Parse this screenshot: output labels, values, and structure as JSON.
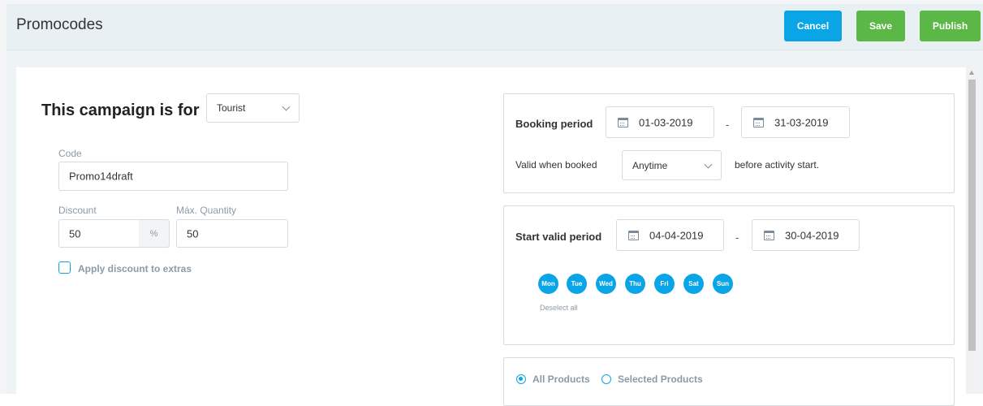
{
  "header": {
    "title": "Promocodes",
    "cancel_label": "Cancel",
    "save_label": "Save",
    "publish_label": "Publish"
  },
  "campaign": {
    "label": "This campaign is for",
    "audience": "Tourist"
  },
  "code": {
    "label": "Code",
    "value": "Promo14draft"
  },
  "discount": {
    "label": "Discount",
    "value": "50",
    "unit": "%"
  },
  "max_quantity": {
    "label": "Máx. Quantity",
    "value": "50"
  },
  "extras": {
    "label": "Apply discount to extras",
    "checked": false
  },
  "booking_period": {
    "label": "Booking period",
    "start": "01-03-2019",
    "end": "31-03-2019",
    "separator": "-",
    "valid_prefix": "Valid when booked",
    "valid_option": "Anytime",
    "valid_suffix": "before activity start."
  },
  "start_valid_period": {
    "label": "Start valid period",
    "start": "04-04-2019",
    "end": "30-04-2019",
    "separator": "-",
    "days": [
      "Mon",
      "Tue",
      "Wed",
      "Thu",
      "Fri",
      "Sat",
      "Sun"
    ],
    "deselect_label": "Deselect all"
  },
  "products": {
    "all_label": "All Products",
    "selected_label": "Selected Products",
    "selected": "All Products"
  },
  "colors": {
    "accent": "#0aa5e6",
    "save": "#5cb846",
    "publish": "#5cb846"
  }
}
